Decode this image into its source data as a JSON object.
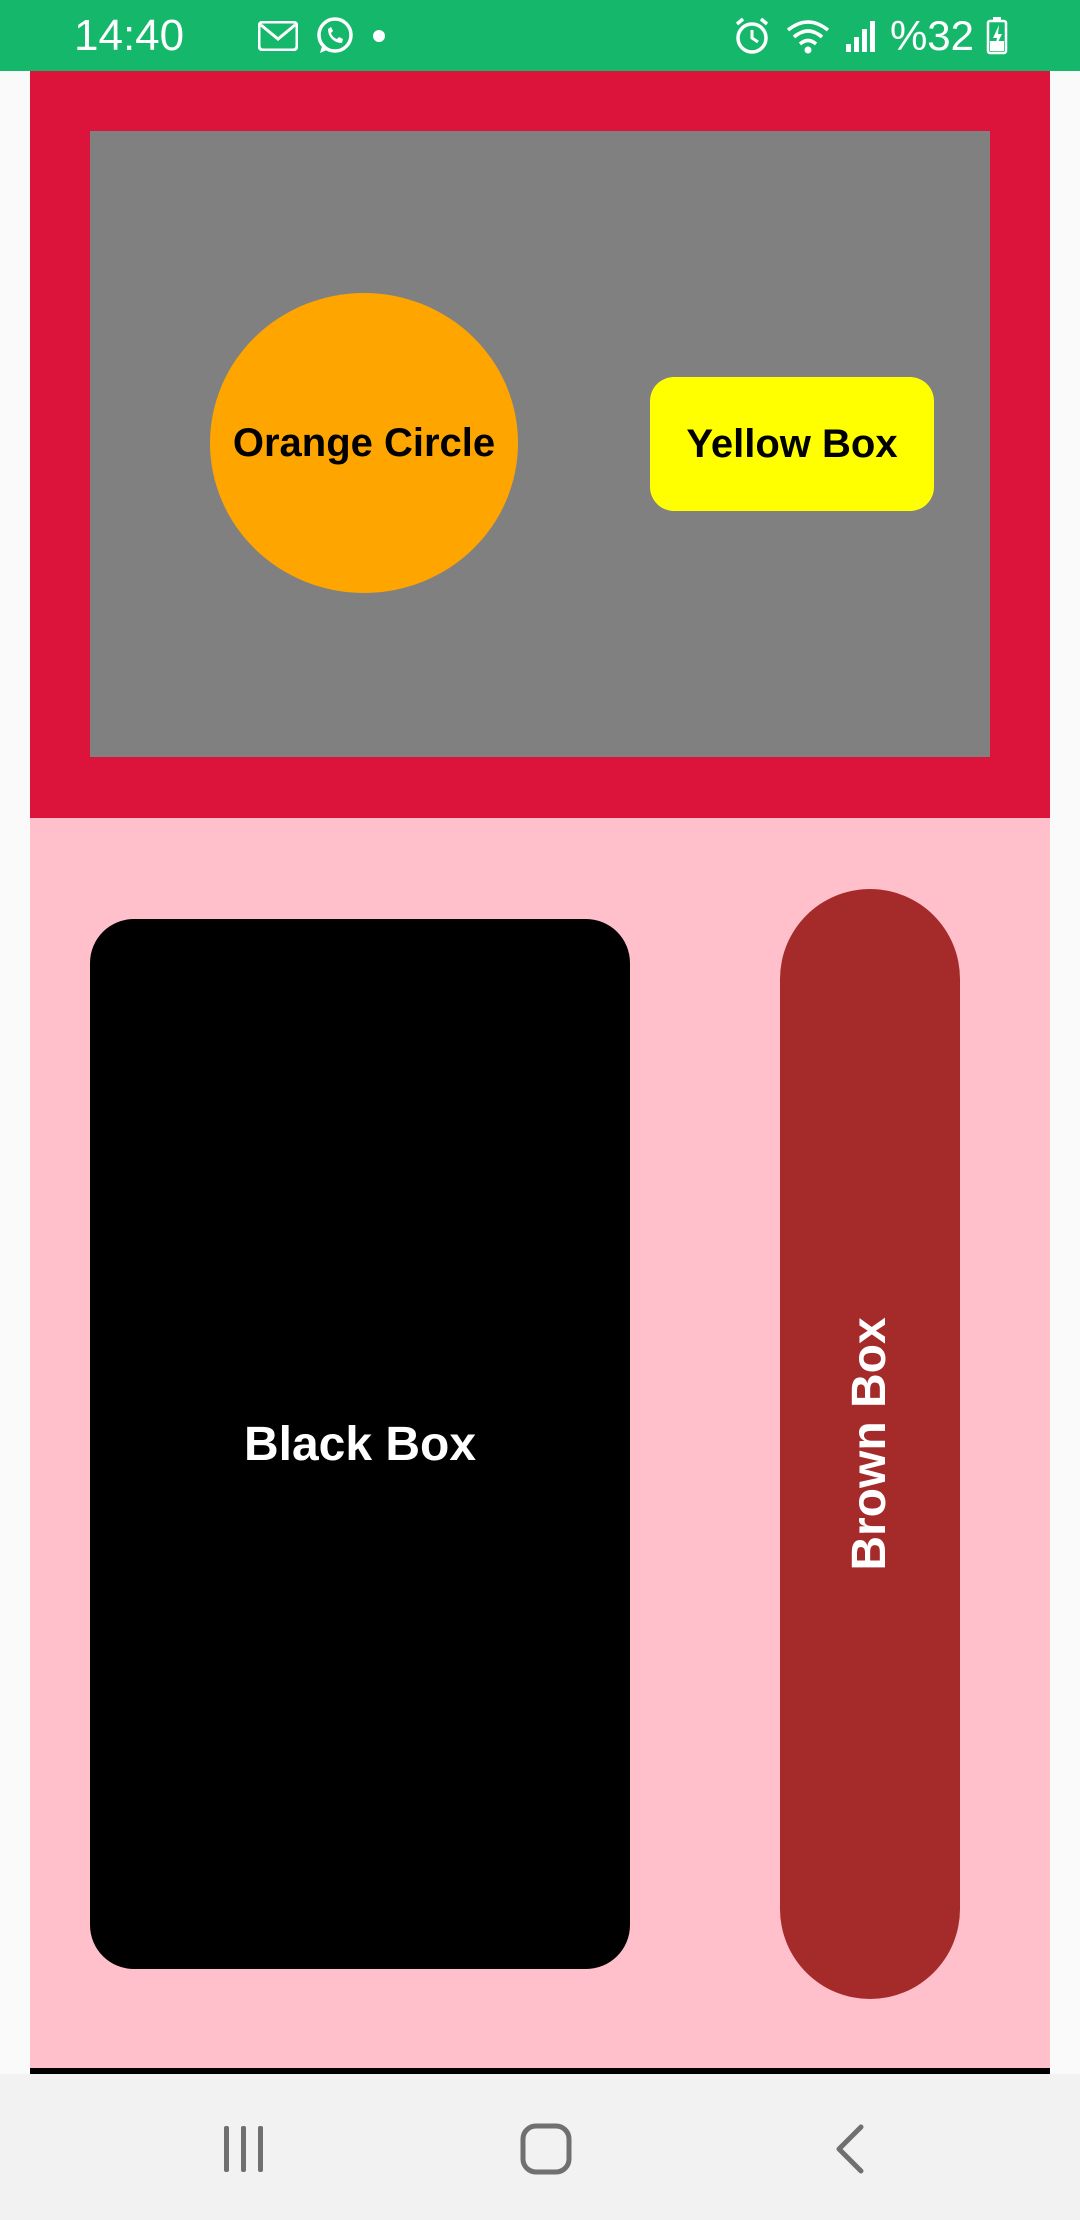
{
  "status_bar": {
    "time": "14:40",
    "battery": "%32",
    "background_color": "#15b86b",
    "left_icons": [
      "gmail-icon",
      "whatsapp-icon",
      "notification-dot-icon"
    ],
    "right_icons": [
      "alarm-icon",
      "wifi-icon",
      "signal-icon",
      "battery-charging-icon"
    ]
  },
  "top_container": {
    "color": "#dc143c",
    "panel_color": "#808080",
    "orange_circle": {
      "label": "Orange Circle",
      "color": "#ffa500"
    },
    "yellow_box": {
      "label": "Yellow Box",
      "color": "#ffff00"
    }
  },
  "bottom_container": {
    "color": "#ffc0cb",
    "black_box": {
      "label": "Black Box",
      "color": "#000000"
    },
    "brown_box": {
      "label": "Brown Box",
      "color": "#a52a2a"
    }
  },
  "nav_bar": {
    "buttons": [
      "recent-apps-icon",
      "home-icon",
      "back-icon"
    ]
  }
}
